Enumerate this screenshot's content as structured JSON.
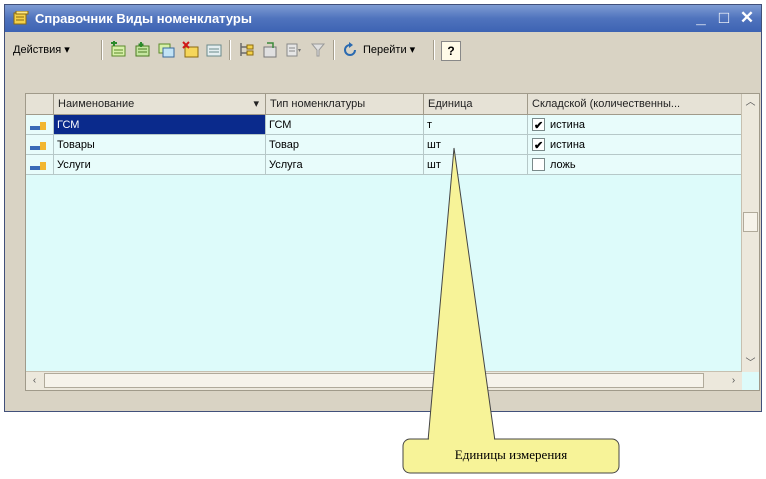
{
  "window": {
    "title": "Справочник Виды номенклатуры",
    "minimize_glyph": "_",
    "maximize_glyph": "□",
    "close_glyph": "✕",
    "title_bar_color": "#3d63b3"
  },
  "toolbar": {
    "actions_label": "Действия",
    "actions_arrow": "▾",
    "goto_label": "Перейти",
    "goto_arrow": "▾",
    "help_label": "?",
    "icons": [
      "add-icon",
      "add-group-icon",
      "copy-icon",
      "delete-icon",
      "edit-icon",
      "hierarchy-icon",
      "move-to-group-icon",
      "filter-icon",
      "cancel-filter-icon",
      "refresh-icon"
    ]
  },
  "table": {
    "columns": [
      {
        "label": "Наименование",
        "sort_marker": "▾"
      },
      {
        "label": "Тип номенклатуры"
      },
      {
        "label": "Единица"
      },
      {
        "label": "Складской (количественны..."
      }
    ],
    "rows": [
      {
        "name": "ГСМ",
        "type": "ГСМ",
        "unit": "т",
        "stock_checked": true,
        "stock_text": "истина",
        "selected": true
      },
      {
        "name": "Товары",
        "type": "Товар",
        "unit": "шт",
        "stock_checked": true,
        "stock_text": "истина",
        "selected": false
      },
      {
        "name": "Услуги",
        "type": "Услуга",
        "unit": "шт",
        "stock_checked": false,
        "stock_text": "ложь",
        "selected": false
      }
    ],
    "check_glyph": "✔",
    "row_background": "#e8fcfb",
    "selection_color": "#0a2a8c"
  },
  "scrollbars": {
    "up_glyph": "︿",
    "down_glyph": "﹀",
    "left_glyph": "‹",
    "right_glyph": "›"
  },
  "callout": {
    "label": "Единицы измерения",
    "fill_color": "#f7f398"
  }
}
